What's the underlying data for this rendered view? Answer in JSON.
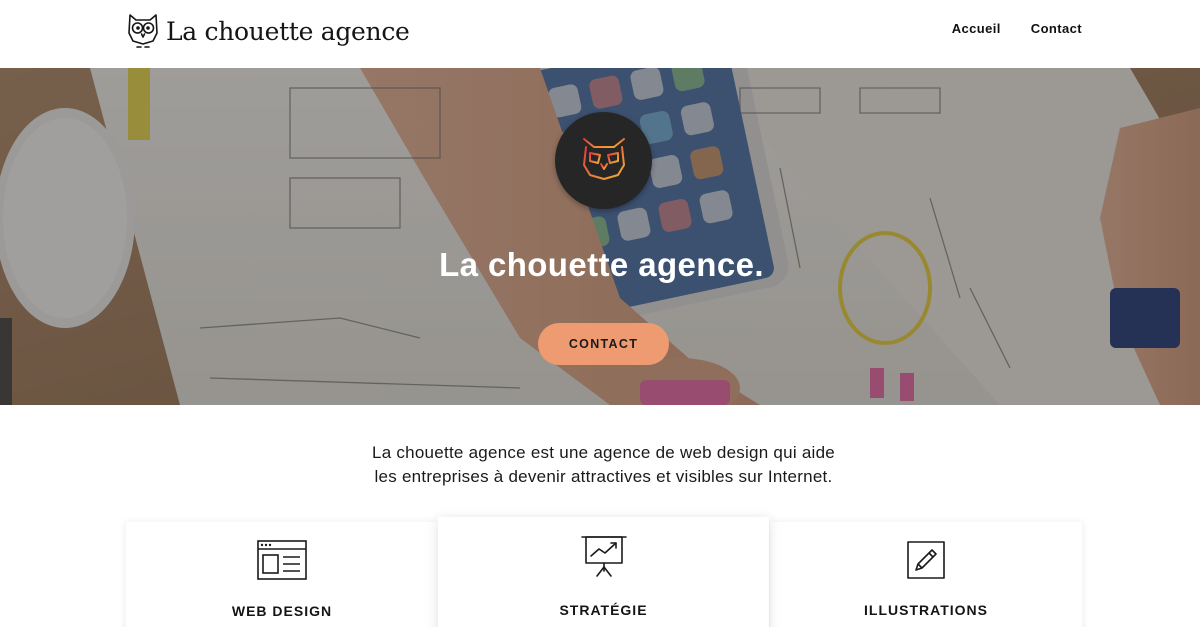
{
  "header": {
    "brand_name": "La chouette agence",
    "nav": [
      {
        "label": "Accueil"
      },
      {
        "label": "Contact"
      }
    ]
  },
  "hero": {
    "title": "La chouette agence.",
    "cta_label": "CONTACT"
  },
  "intro": {
    "line1": "La chouette agence est une agence de web design qui aide",
    "line2": "les entreprises à devenir attractives et visibles sur Internet."
  },
  "services": [
    {
      "title": "WEB DESIGN",
      "icon": "browser-window-icon"
    },
    {
      "title": "STRATÉGIE",
      "icon": "presentation-chart-icon"
    },
    {
      "title": "ILLUSTRATIONS",
      "icon": "pencil-square-icon"
    }
  ],
  "colors": {
    "accent": "#ef9b72",
    "logo_circle": "#262626",
    "logo_gradient_start": "#e23b3b",
    "logo_gradient_end": "#f2b134"
  }
}
